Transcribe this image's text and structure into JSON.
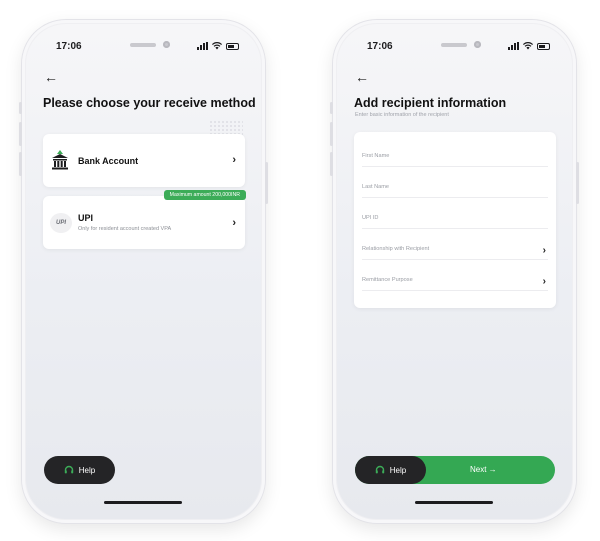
{
  "status_bar": {
    "time": "17:06"
  },
  "screen_method": {
    "back_icon": "arrow-left",
    "title": "Please choose your receive method",
    "options": [
      {
        "label": "Bank Account",
        "icon": "bank-icon",
        "chevron": "›"
      },
      {
        "label": "UPI",
        "description": "Only for resident account created VPA",
        "badge": "Maximum amount 200,000INR",
        "icon": "upi-logo",
        "logo_text": "UPI",
        "chevron": "›"
      }
    ],
    "help_label": "Help"
  },
  "screen_recipient": {
    "back_icon": "arrow-left",
    "title": "Add recipient information",
    "subtitle": "Enter basic information of the recipient",
    "fields": [
      {
        "label": "First Name"
      },
      {
        "label": "Last Name"
      },
      {
        "label": "UPI ID"
      },
      {
        "label": "Relationship with Recipient",
        "chevron": "›"
      },
      {
        "label": "Remittance Purpose",
        "chevron": "›"
      }
    ],
    "help_label": "Help",
    "next_label": "Next →"
  },
  "colors": {
    "accent_green": "#34a853",
    "dark_button": "#242426"
  }
}
